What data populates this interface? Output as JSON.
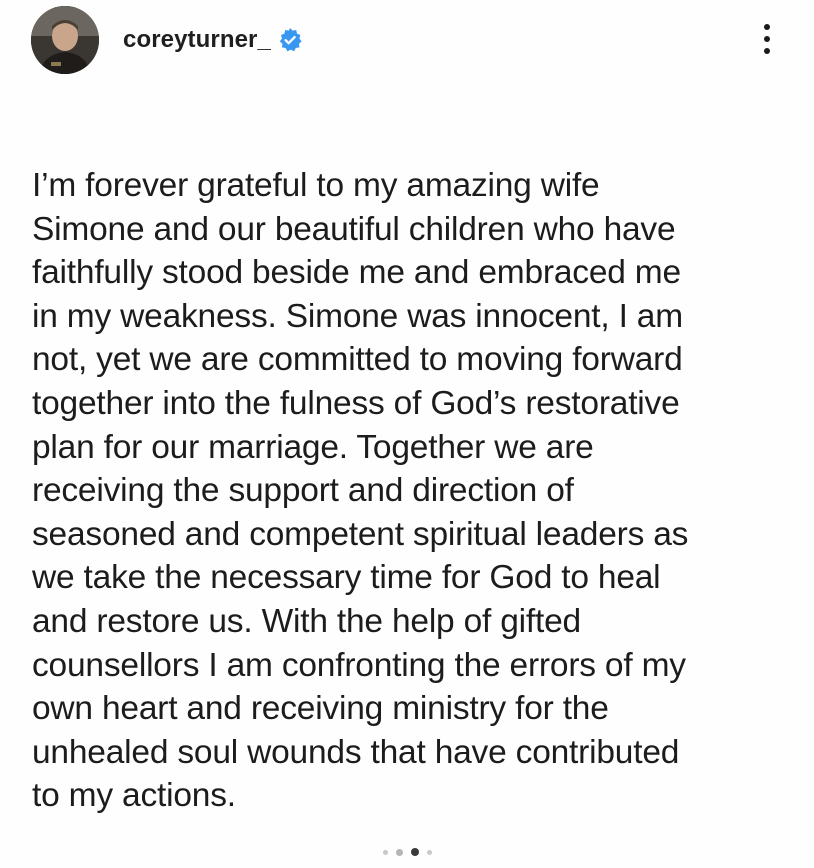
{
  "header": {
    "username": "coreyturner_",
    "verified": true,
    "avatar_icon": "profile-avatar",
    "more_icon": "more-vertical-icon"
  },
  "post": {
    "caption_lines": [
      "I’m forever grateful to my amazing wife",
      "Simone and our beautiful children who have",
      "faithfully stood beside me and embraced me",
      "in my weakness. Simone was innocent, I am",
      "not, yet we are committed to moving forward",
      "together into the fulness of God’s restorative",
      "plan for our marriage. Together we are",
      "receiving the support and direction of",
      "seasoned and competent spiritual leaders as",
      "we take the necessary time for God to heal",
      "and restore us. With the help of gifted",
      "counsellors I am confronting the errors of my",
      "own heart and receiving ministry for the",
      "unhealed soul wounds that have contributed",
      "to my actions."
    ]
  },
  "carousel": {
    "total": 4,
    "active_index": 2
  },
  "colors": {
    "verified_badge": "#3897f0",
    "text": "#1c1c1c",
    "background": "#fefefe"
  }
}
